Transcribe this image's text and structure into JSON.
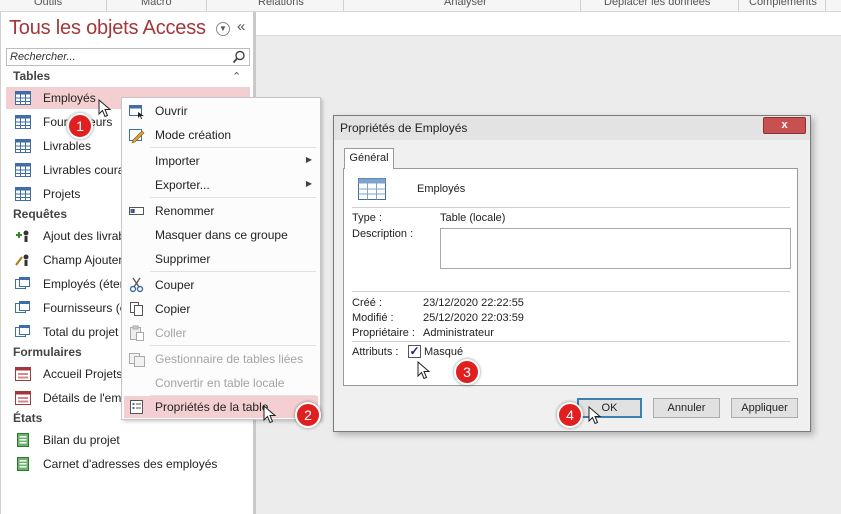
{
  "ribbon": {
    "groups": [
      "Outils",
      "Macro",
      "Relations",
      "Analyser",
      "Déplacer les données",
      "Compléments"
    ]
  },
  "nav": {
    "title": "Tous les objets Access",
    "search_placeholder": "Rechercher...",
    "sections": {
      "tables": "Tables",
      "requetes": "Requêtes",
      "formulaires": "Formulaires",
      "etats": "États"
    },
    "tables": [
      "Employés",
      "Fournisseurs",
      "Livrables",
      "Livrables courants",
      "Projets"
    ],
    "requetes": [
      "Ajout des livrables",
      "Champ Ajouter/Modifier",
      "Employés (étendu)",
      "Fournisseurs (étendu)",
      "Total du projet"
    ],
    "formulaires": [
      "Accueil Projets et",
      "Détails de l'employé"
    ],
    "etats": [
      "Bilan du projet",
      "Carnet d'adresses des employés"
    ]
  },
  "context_menu": {
    "items": [
      {
        "label": "Ouvrir",
        "icon": "open-icon",
        "disabled": false,
        "submenu": false
      },
      {
        "label": "Mode création",
        "icon": "design-view-icon",
        "disabled": false,
        "submenu": false
      },
      {
        "label": "Importer",
        "icon": "",
        "disabled": false,
        "submenu": true
      },
      {
        "label": "Exporter...",
        "icon": "",
        "disabled": false,
        "submenu": true
      },
      {
        "label": "Renommer",
        "icon": "rename-icon",
        "disabled": false,
        "submenu": false
      },
      {
        "label": "Masquer dans ce groupe",
        "icon": "",
        "disabled": false,
        "submenu": false
      },
      {
        "label": "Supprimer",
        "icon": "",
        "disabled": false,
        "submenu": false
      },
      {
        "label": "Couper",
        "icon": "scissors-icon",
        "disabled": false,
        "submenu": false
      },
      {
        "label": "Copier",
        "icon": "copy-icon",
        "disabled": false,
        "submenu": false
      },
      {
        "label": "Coller",
        "icon": "paste-icon",
        "disabled": true,
        "submenu": false
      },
      {
        "label": "Gestionnaire de tables liées",
        "icon": "linked-table-manager-icon",
        "disabled": true,
        "submenu": false
      },
      {
        "label": "Convertir en table locale",
        "icon": "",
        "disabled": true,
        "submenu": false
      },
      {
        "label": "Propriétés de la table",
        "icon": "properties-icon",
        "disabled": false,
        "submenu": false
      }
    ]
  },
  "dialog": {
    "title": "Propriétés de Employés",
    "close": "x",
    "tab": "Général",
    "object_name": "Employés",
    "type_label": "Type :",
    "type_value": "Table (locale)",
    "description_label": "Description :",
    "created_label": "Créé :",
    "created_value": "23/12/2020 22:22:55",
    "modified_label": "Modifié :",
    "modified_value": "25/12/2020 22:03:59",
    "owner_label": "Propriétaire :",
    "owner_value": "Administrateur",
    "attributes_label": "Attributs :",
    "hidden_label": "Masqué",
    "hidden_checked": true,
    "ok": "OK",
    "cancel": "Annuler",
    "apply": "Appliquer"
  },
  "callouts": [
    "1",
    "2",
    "3",
    "4"
  ],
  "colors": {
    "accent": "#a4373a",
    "selection": "#f4cfd1",
    "callout": "#e02020"
  }
}
